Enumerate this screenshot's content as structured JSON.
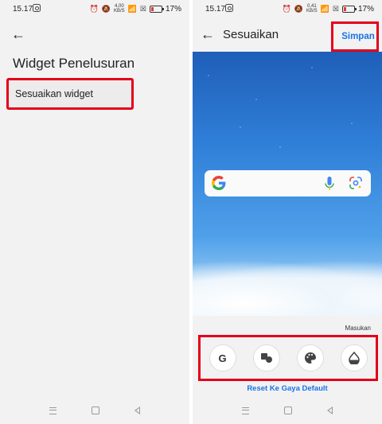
{
  "left_screen": {
    "status": {
      "time": "15.17",
      "battery_pct": "17%"
    },
    "title": "Widget Penelusuran",
    "item_label": "Sesuaikan widget"
  },
  "right_screen": {
    "status": {
      "time": "15.17",
      "battery_pct": "17%",
      "speed_value": "0,41",
      "speed_unit": "KB/S"
    },
    "title": "Sesuaikan",
    "save_label": "Simpan",
    "feedback_label": "Masukan",
    "reset_label": "Reset Ke Gaya Default",
    "style_options": [
      "google-logo-style",
      "shape-style",
      "color-palette",
      "transparency"
    ]
  },
  "left_status_speed": {
    "value": "4,00",
    "unit": "KB/S"
  },
  "colors": {
    "accent": "#1a73e8",
    "highlight": "#e3001b"
  }
}
